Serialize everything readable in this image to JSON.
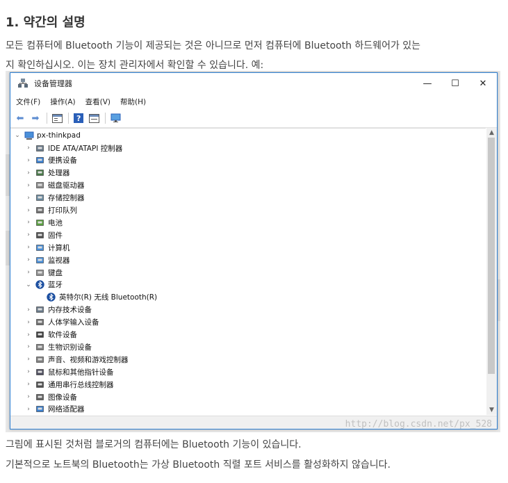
{
  "article": {
    "heading": "1. 약간의 설명",
    "para1_line1": "모든 컴퓨터에 Bluetooth 기능이 제공되는 것은 아니므로 먼저 컴퓨터에 Bluetooth 하드웨어가 있는",
    "para1_line2": "지 확인하십시오. 이는 장치 관리자에서 확인할 수 있습니다. 예:",
    "para2": "그림에 표시된 것처럼 블로거의 컴퓨터에는 Bluetooth 기능이 있습니다.",
    "para3": "기본적으로 노트북의 Bluetooth는 가상 Bluetooth 직렬 포트 서비스를 활성화하지 않습니다."
  },
  "window": {
    "title": "设备管理器",
    "min_glyph": "—",
    "max_glyph": "☐",
    "close_glyph": "✕",
    "menu": [
      "文件(F)",
      "操作(A)",
      "查看(V)",
      "帮助(H)"
    ],
    "toolbar_icons": [
      "back-arrow-icon",
      "forward-arrow-icon",
      "properties-icon",
      "help-icon",
      "details-icon",
      "monitor-icon"
    ]
  },
  "tree": {
    "root": "px-thinkpad",
    "items": [
      {
        "label": "IDE ATA/ATAPI 控制器",
        "icon": "ide-controller-icon",
        "expanded": false
      },
      {
        "label": "便携设备",
        "icon": "portable-device-icon",
        "expanded": false
      },
      {
        "label": "处理器",
        "icon": "processor-icon",
        "expanded": false
      },
      {
        "label": "磁盘驱动器",
        "icon": "disk-drive-icon",
        "expanded": false
      },
      {
        "label": "存储控制器",
        "icon": "storage-controller-icon",
        "expanded": false
      },
      {
        "label": "打印队列",
        "icon": "printer-icon",
        "expanded": false
      },
      {
        "label": "电池",
        "icon": "battery-icon",
        "expanded": false
      },
      {
        "label": "固件",
        "icon": "firmware-icon",
        "expanded": false
      },
      {
        "label": "计算机",
        "icon": "computer-icon",
        "expanded": false
      },
      {
        "label": "监视器",
        "icon": "monitor-icon",
        "expanded": false
      },
      {
        "label": "键盘",
        "icon": "keyboard-icon",
        "expanded": false
      },
      {
        "label": "蓝牙",
        "icon": "bluetooth-icon",
        "expanded": true
      },
      {
        "label": "英特尔(R) 无线 Bluetooth(R)",
        "icon": "bluetooth-icon",
        "child": true
      },
      {
        "label": "内存技术设备",
        "icon": "memory-device-icon",
        "expanded": false
      },
      {
        "label": "人体学输入设备",
        "icon": "hid-icon",
        "expanded": false
      },
      {
        "label": "软件设备",
        "icon": "software-device-icon",
        "expanded": false
      },
      {
        "label": "生物识别设备",
        "icon": "fingerprint-icon",
        "expanded": false
      },
      {
        "label": "声音、视频和游戏控制器",
        "icon": "speaker-icon",
        "expanded": false
      },
      {
        "label": "鼠标和其他指针设备",
        "icon": "mouse-icon",
        "expanded": false
      },
      {
        "label": "通用串行总线控制器",
        "icon": "usb-icon",
        "expanded": false
      },
      {
        "label": "图像设备",
        "icon": "camera-icon",
        "expanded": false
      },
      {
        "label": "网络适配器",
        "icon": "network-adapter-icon",
        "expanded": false
      }
    ]
  },
  "watermark": "http://blog.csdn.net/px_528",
  "colors": {
    "accent": "#2d7fd1",
    "bluetooth": "#1c4fa0"
  }
}
